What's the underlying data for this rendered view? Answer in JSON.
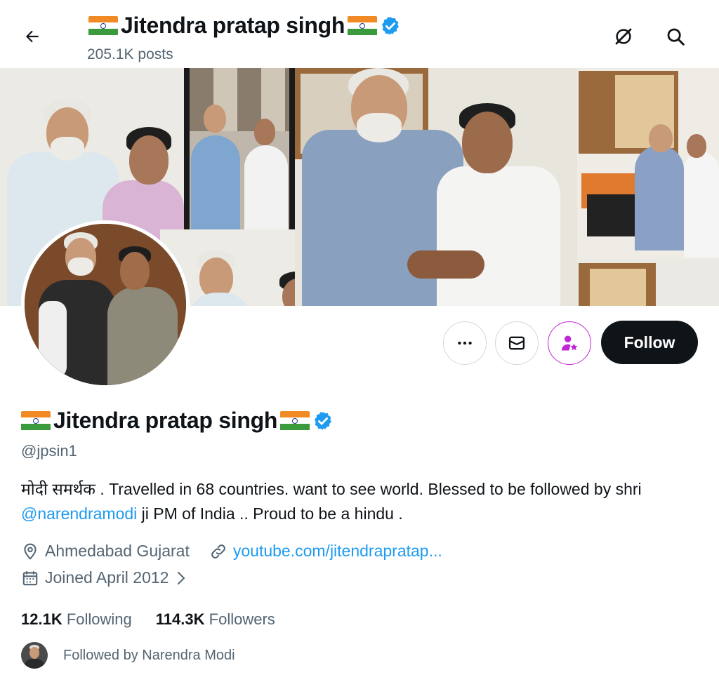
{
  "header": {
    "name": "Jitendra pratap singh",
    "posts": "205.1K posts"
  },
  "profile": {
    "display_name": "Jitendra pratap singh",
    "handle": "@jpsin1",
    "bio_part1": "मोदी समर्थक . Travelled in 68 countries. want to see world. Blessed to be followed by shri ",
    "bio_mention": "@narendramodi",
    "bio_part2": " ji PM of India .. Proud to be a hindu .",
    "location": "Ahmedabad Gujarat",
    "website": "youtube.com/jitendrapratap...",
    "joined": "Joined April 2012"
  },
  "actions": {
    "follow_label": "Follow"
  },
  "stats": {
    "following_count": "12.1K",
    "following_label": "Following",
    "followers_count": "114.3K",
    "followers_label": "Followers"
  },
  "followed_by": "Followed by Narendra Modi",
  "icons": [
    "back-arrow-icon",
    "grok-icon",
    "search-icon",
    "more-icon",
    "message-icon",
    "subscribe-icon",
    "verified-badge-icon",
    "location-icon",
    "link-icon",
    "calendar-icon",
    "chevron-right-icon"
  ],
  "colors": {
    "accent": "#1d9bf0",
    "text": "#0f1419",
    "secondary": "#536471",
    "follow_bg": "#0f1419",
    "subscribe": "#c026d3"
  }
}
